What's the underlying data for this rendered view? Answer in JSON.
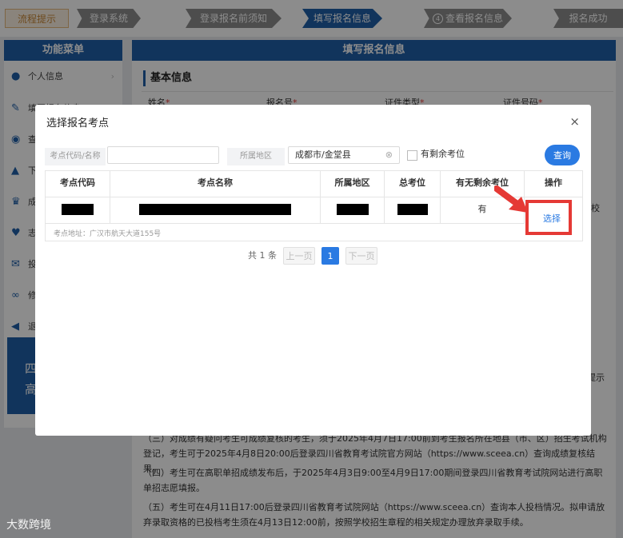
{
  "steps": [
    {
      "label": "流程提示"
    },
    {
      "label": "登录系统"
    },
    {
      "label": "登录报名前须知"
    },
    {
      "label": "填写报名信息"
    },
    {
      "label": "查看报名信息"
    },
    {
      "label": "报名成功"
    }
  ],
  "sidebar": {
    "title": "功能菜单",
    "items": [
      {
        "label": "个人信息",
        "icon": "user-icon"
      },
      {
        "label": "填写报名信息",
        "icon": "edit-icon"
      },
      {
        "label": "查",
        "icon": "eye-icon"
      },
      {
        "label": "下",
        "icon": "upload-icon"
      },
      {
        "label": "成",
        "icon": "trophy-icon"
      },
      {
        "label": "志",
        "icon": "heart-icon"
      },
      {
        "label": "投",
        "icon": "mail-icon"
      },
      {
        "label": "修",
        "icon": "link-icon"
      },
      {
        "label": "退",
        "icon": "back-arrow-icon"
      }
    ],
    "banner_line1": "四",
    "banner_line2": "高"
  },
  "main": {
    "title": "填写报名信息",
    "section_title": "基本信息",
    "fields": [
      "姓名",
      "报名号",
      "证件类型",
      "证件号码"
    ],
    "required_mark": "*",
    "right_fragment_1": "校",
    "right_fragment_2": "提示",
    "notices": [
      "（三）对成绩有疑问考生可成绩复核的考生，须于2025年4月7日17:00前到考生报名所在地县（市、区）招生考试机构登记，考生可于2025年4月8日20:00后登录四川省教育考试院官方网站（https://www.sceea.cn）查询成绩复核结果。",
      "（四）考生可在高职单招成绩发布后，于2025年4月3日9:00至4月9日17:00期间登录四川省教育考试院网站进行高职单招志愿填报。",
      "（五）考生可在4月11日17:00后登录四川省教育考试院网站（https://www.sceea.cn）查询本人投档情况。拟申请放弃录取资格的已投档考生须在4月13日12:00前，按照学校招生章程的相关规定办理放弃录取手续。"
    ]
  },
  "dialog": {
    "title": "选择报名考点",
    "close": "×",
    "filter": {
      "code_label": "考点代码/名称",
      "code_value": "",
      "region_label": "所属地区",
      "region_value": "成都市/金堂县",
      "clear": "⊗",
      "remaining_label": "有剩余考位",
      "query_button": "查询"
    },
    "table": {
      "headers": [
        "考点代码",
        "考点名称",
        "所属地区",
        "总考位",
        "有无剩余考位",
        "操作"
      ],
      "rows": [
        {
          "remaining": "有",
          "action": "选择",
          "address": "考点地址：广汉市航天大道155号"
        }
      ]
    },
    "pager": {
      "total": "共 1 条",
      "prev": "上一页",
      "current": "1",
      "next": "下一页"
    }
  },
  "watermark": "大数跨境",
  "colors": {
    "primary": "#1f5fa8",
    "accent": "#2a7ae2",
    "highlight": "#e53935"
  }
}
